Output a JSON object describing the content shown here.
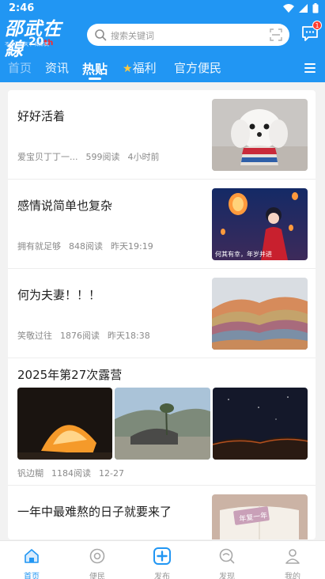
{
  "status": {
    "time": "2:46"
  },
  "logo": {
    "title": "邵武在線",
    "number": "20",
    "sub": "不出门知天下 知邵武"
  },
  "search": {
    "placeholder": "搜索关键词"
  },
  "messages": {
    "badge": "1"
  },
  "tabs": [
    "首页",
    "资讯",
    "热贴",
    "福利",
    "官方便民"
  ],
  "active_tab": "热贴",
  "posts": [
    {
      "title": "好好活着",
      "author": "爱宝贝丁丁一...",
      "reads": "599阅读",
      "time": "4小时前"
    },
    {
      "title": "感情说简单也复杂",
      "author": "拥有就足够",
      "reads": "848阅读",
      "time": "昨天19:19",
      "image_text": "何其有幸，年岁并进"
    },
    {
      "title": "何为夫妻！！！",
      "author": "笑敬过往",
      "reads": "1876阅读",
      "time": "昨天18:38"
    },
    {
      "title": "2025年第27次露营",
      "author": "钒边糊",
      "reads": "1184阅读",
      "time": "12-27"
    },
    {
      "title": "一年中最难熬的日子就要来了",
      "image_text": "年复一年"
    }
  ],
  "bottom_nav": [
    {
      "label": "首页",
      "icon": "home-icon"
    },
    {
      "label": "便民",
      "icon": "service-icon"
    },
    {
      "label": "发布",
      "icon": "publish-icon"
    },
    {
      "label": "发现",
      "icon": "discover-icon"
    },
    {
      "label": "我的",
      "icon": "profile-icon"
    }
  ],
  "colors": {
    "primary": "#2196f3",
    "badge": "#ff3b30"
  }
}
